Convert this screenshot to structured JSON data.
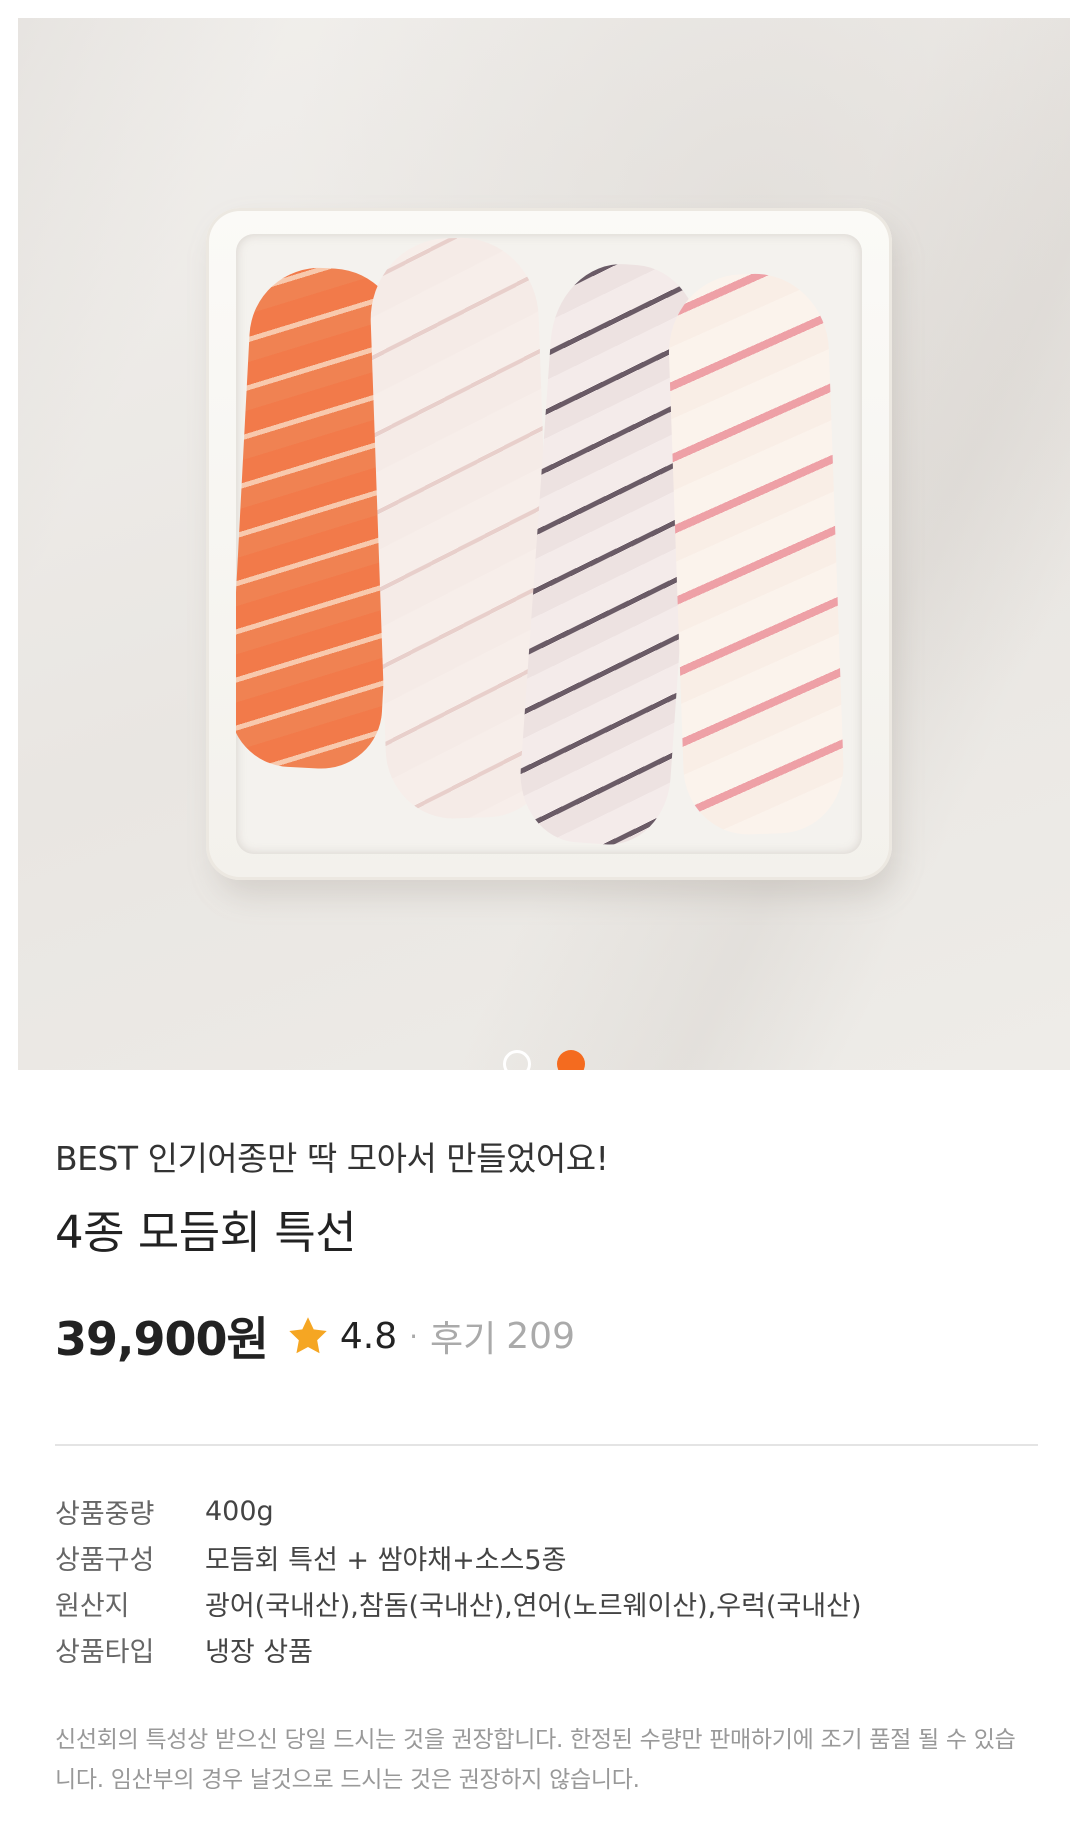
{
  "gallery": {
    "image_alt": "모둠회 트레이",
    "total_slides": 2,
    "active_slide": 2
  },
  "product": {
    "subtitle": "BEST 인기어종만 딱 모아서 만들었어요!",
    "title": "4종 모듬회 특선",
    "price": "39,900원",
    "rating": "4.8",
    "separator": "·",
    "review_label": "후기",
    "review_count": "209"
  },
  "info": [
    {
      "label": "상품중량",
      "value": "400g"
    },
    {
      "label": "상품구성",
      "value": "모듬회 특선 + 쌈야채+소스5종"
    },
    {
      "label": "원산지",
      "value": "광어(국내산),참돔(국내산),연어(노르웨이산),우럭(국내산)"
    },
    {
      "label": "상품타입",
      "value": "냉장 상품"
    }
  ],
  "notice": "신선회의 특성상 받으신 당일 드시는 것을 권장합니다. 한정된 수량만 판매하기에 조기 품절 될 수 있습니다. 임산부의 경우 날것으로 드시는 것은 권장하지 않습니다.",
  "colors": {
    "accent": "#f46b1f",
    "star": "#f5a623",
    "muted_text": "#aaaaaa"
  },
  "icons": {
    "star": "star-icon"
  }
}
